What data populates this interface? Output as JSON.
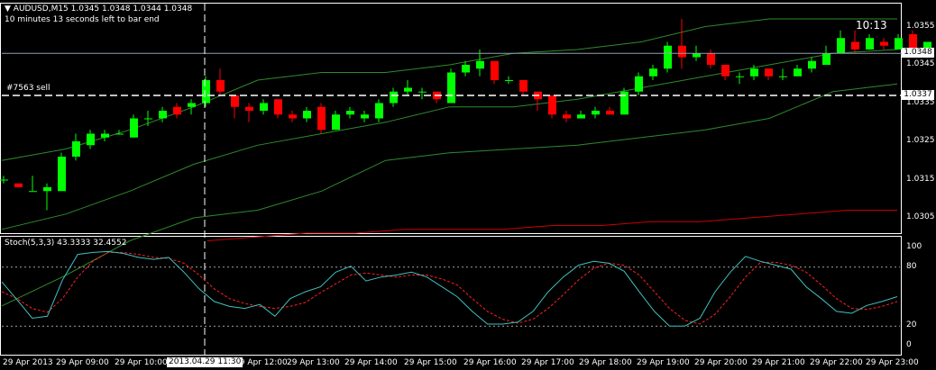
{
  "header": {
    "symbol_line": "AUDUSD,M15  1.0345 1.0348 1.0344 1.0348",
    "countdown_line": "10 minutes 13 seconds left to bar end",
    "timer": "10:13"
  },
  "order": {
    "label": "#7563 sell",
    "price": 1.0337,
    "price_label": "1.0337"
  },
  "current_price": {
    "value": 1.0348,
    "label": "1.0348"
  },
  "price_axis": {
    "ticks": [
      {
        "value": 1.0355,
        "label": "1.0355"
      },
      {
        "value": 1.0345,
        "label": "1.0345"
      },
      {
        "value": 1.0335,
        "label": "1.0335"
      },
      {
        "value": 1.0325,
        "label": "1.0325"
      },
      {
        "value": 1.0315,
        "label": "1.0315"
      },
      {
        "value": 1.0305,
        "label": "1.0305"
      }
    ],
    "min": 1.0301,
    "max": 1.0361
  },
  "stoch": {
    "title": "Stoch(5,3,3) 43.3333 32.4552",
    "levels": [
      80,
      20
    ],
    "ticks": [
      {
        "value": 100,
        "label": "100"
      },
      {
        "value": 80,
        "label": "80"
      },
      {
        "value": 20,
        "label": "20"
      },
      {
        "value": 0,
        "label": "0"
      }
    ]
  },
  "time_axis": {
    "labels": [
      "29 Apr 2013",
      "29 Apr 09:00",
      "29 Apr 10:00",
      "29 Apr 12:00",
      "29 Apr 13:00",
      "29 Apr 14:00",
      "29 Apr 15:00",
      "29 Apr 16:00",
      "29 Apr 17:00",
      "29 Apr 18:00",
      "29 Apr 19:00",
      "29 Apr 20:00",
      "29 Apr 21:00",
      "29 Apr 22:00",
      "29 Apr 23:00"
    ],
    "cursor_label": "2013.04.29 11:30"
  },
  "colors": {
    "bull": "#00ff00",
    "bear": "#ff0000",
    "band": "#2e8b2e",
    "ma": "#cc0000",
    "stoch_main": "#40c0c0",
    "stoch_signal": "#ff2020"
  },
  "chart_data": {
    "type": "candlestick",
    "candles": [
      {
        "o": 1.0315,
        "h": 1.0316,
        "l": 1.0314,
        "c": 1.0315
      },
      {
        "o": 1.0314,
        "h": 1.0314,
        "l": 1.0313,
        "c": 1.0313
      },
      {
        "o": 1.0312,
        "h": 1.0316,
        "l": 1.0312,
        "c": 1.0312
      },
      {
        "o": 1.0312,
        "h": 1.0314,
        "l": 1.0307,
        "c": 1.0313
      },
      {
        "o": 1.0312,
        "h": 1.0322,
        "l": 1.0312,
        "c": 1.0321
      },
      {
        "o": 1.0321,
        "h": 1.0327,
        "l": 1.032,
        "c": 1.0325
      },
      {
        "o": 1.0324,
        "h": 1.0328,
        "l": 1.0323,
        "c": 1.0327
      },
      {
        "o": 1.0326,
        "h": 1.0328,
        "l": 1.0325,
        "c": 1.0327
      },
      {
        "o": 1.0327,
        "h": 1.0328,
        "l": 1.0327,
        "c": 1.0327
      },
      {
        "o": 1.0326,
        "h": 1.0332,
        "l": 1.0326,
        "c": 1.0331
      },
      {
        "o": 1.0331,
        "h": 1.0333,
        "l": 1.0329,
        "c": 1.0331
      },
      {
        "o": 1.0331,
        "h": 1.0334,
        "l": 1.033,
        "c": 1.0333
      },
      {
        "o": 1.0334,
        "h": 1.0335,
        "l": 1.0331,
        "c": 1.0332
      },
      {
        "o": 1.0334,
        "h": 1.0336,
        "l": 1.0332,
        "c": 1.0335
      },
      {
        "o": 1.0335,
        "h": 1.0342,
        "l": 1.0334,
        "c": 1.0341
      },
      {
        "o": 1.0341,
        "h": 1.0344,
        "l": 1.0337,
        "c": 1.0338
      },
      {
        "o": 1.0337,
        "h": 1.0337,
        "l": 1.0331,
        "c": 1.0334
      },
      {
        "o": 1.0334,
        "h": 1.0335,
        "l": 1.033,
        "c": 1.0333
      },
      {
        "o": 1.0333,
        "h": 1.0336,
        "l": 1.0332,
        "c": 1.0335
      },
      {
        "o": 1.0336,
        "h": 1.0336,
        "l": 1.0331,
        "c": 1.0332
      },
      {
        "o": 1.0332,
        "h": 1.0333,
        "l": 1.033,
        "c": 1.0331
      },
      {
        "o": 1.0331,
        "h": 1.0334,
        "l": 1.033,
        "c": 1.0333
      },
      {
        "o": 1.0334,
        "h": 1.0335,
        "l": 1.0327,
        "c": 1.0328
      },
      {
        "o": 1.0328,
        "h": 1.0333,
        "l": 1.0328,
        "c": 1.0332
      },
      {
        "o": 1.0332,
        "h": 1.0334,
        "l": 1.0331,
        "c": 1.0333
      },
      {
        "o": 1.0331,
        "h": 1.0333,
        "l": 1.033,
        "c": 1.0332
      },
      {
        "o": 1.0331,
        "h": 1.0336,
        "l": 1.033,
        "c": 1.0335
      },
      {
        "o": 1.0335,
        "h": 1.0339,
        "l": 1.0334,
        "c": 1.0338
      },
      {
        "o": 1.0338,
        "h": 1.0341,
        "l": 1.0337,
        "c": 1.0339
      },
      {
        "o": 1.0338,
        "h": 1.0339,
        "l": 1.0336,
        "c": 1.0338
      },
      {
        "o": 1.0338,
        "h": 1.0338,
        "l": 1.0335,
        "c": 1.0336
      },
      {
        "o": 1.0335,
        "h": 1.0344,
        "l": 1.0335,
        "c": 1.0343
      },
      {
        "o": 1.0343,
        "h": 1.0346,
        "l": 1.0342,
        "c": 1.0345
      },
      {
        "o": 1.0344,
        "h": 1.0349,
        "l": 1.0342,
        "c": 1.0346
      },
      {
        "o": 1.0346,
        "h": 1.0346,
        "l": 1.034,
        "c": 1.0341
      },
      {
        "o": 1.0341,
        "h": 1.0342,
        "l": 1.034,
        "c": 1.0341
      },
      {
        "o": 1.0341,
        "h": 1.0341,
        "l": 1.0337,
        "c": 1.0338
      },
      {
        "o": 1.0338,
        "h": 1.0338,
        "l": 1.0333,
        "c": 1.0336
      },
      {
        "o": 1.0337,
        "h": 1.0337,
        "l": 1.0331,
        "c": 1.0332
      },
      {
        "o": 1.0332,
        "h": 1.0333,
        "l": 1.033,
        "c": 1.0331
      },
      {
        "o": 1.0331,
        "h": 1.0333,
        "l": 1.0331,
        "c": 1.0332
      },
      {
        "o": 1.0332,
        "h": 1.0334,
        "l": 1.0331,
        "c": 1.0333
      },
      {
        "o": 1.0333,
        "h": 1.0334,
        "l": 1.0332,
        "c": 1.0332
      },
      {
        "o": 1.0332,
        "h": 1.0339,
        "l": 1.0332,
        "c": 1.0338
      },
      {
        "o": 1.0338,
        "h": 1.0343,
        "l": 1.0337,
        "c": 1.0342
      },
      {
        "o": 1.0342,
        "h": 1.0345,
        "l": 1.0341,
        "c": 1.0344
      },
      {
        "o": 1.0344,
        "h": 1.0351,
        "l": 1.0343,
        "c": 1.035
      },
      {
        "o": 1.035,
        "h": 1.0357,
        "l": 1.0344,
        "c": 1.0347
      },
      {
        "o": 1.0347,
        "h": 1.035,
        "l": 1.0346,
        "c": 1.0348
      },
      {
        "o": 1.0348,
        "h": 1.0349,
        "l": 1.0344,
        "c": 1.0345
      },
      {
        "o": 1.0345,
        "h": 1.0345,
        "l": 1.0341,
        "c": 1.0342
      },
      {
        "o": 1.0342,
        "h": 1.0343,
        "l": 1.034,
        "c": 1.0342
      },
      {
        "o": 1.0342,
        "h": 1.0345,
        "l": 1.0341,
        "c": 1.0344
      },
      {
        "o": 1.0344,
        "h": 1.0344,
        "l": 1.0341,
        "c": 1.0342
      },
      {
        "o": 1.0342,
        "h": 1.0344,
        "l": 1.0341,
        "c": 1.0342
      },
      {
        "o": 1.0342,
        "h": 1.0345,
        "l": 1.0342,
        "c": 1.0344
      },
      {
        "o": 1.0344,
        "h": 1.0347,
        "l": 1.0343,
        "c": 1.0346
      },
      {
        "o": 1.0345,
        "h": 1.035,
        "l": 1.0345,
        "c": 1.0348
      },
      {
        "o": 1.0348,
        "h": 1.0354,
        "l": 1.0348,
        "c": 1.0352
      },
      {
        "o": 1.0351,
        "h": 1.0354,
        "l": 1.0348,
        "c": 1.0349
      },
      {
        "o": 1.0349,
        "h": 1.0353,
        "l": 1.0349,
        "c": 1.0352
      },
      {
        "o": 1.0351,
        "h": 1.0352,
        "l": 1.0349,
        "c": 1.035
      },
      {
        "o": 1.0349,
        "h": 1.0353,
        "l": 1.0349,
        "c": 1.0352
      },
      {
        "o": 1.0353,
        "h": 1.0354,
        "l": 1.0348,
        "c": 1.0349
      },
      {
        "o": 1.0349,
        "h": 1.0351,
        "l": 1.0348,
        "c": 1.0351
      },
      {
        "o": 1.035,
        "h": 1.0353,
        "l": 1.0348,
        "c": 1.0352
      },
      {
        "o": 1.0351,
        "h": 1.0352,
        "l": 1.0349,
        "c": 1.0351
      },
      {
        "o": 1.0348,
        "h": 1.0353,
        "l": 1.0347,
        "c": 1.0351
      },
      {
        "o": 1.0351,
        "h": 1.0353,
        "l": 1.0349,
        "c": 1.0352
      },
      {
        "o": 1.0351,
        "h": 1.0352,
        "l": 1.0347,
        "c": 1.0348
      }
    ],
    "bands": {
      "upper": [
        1.032,
        1.0323,
        1.0328,
        1.0334,
        1.0341,
        1.0343,
        1.0343,
        1.0345,
        1.0348,
        1.0349,
        1.0351,
        1.0355,
        1.0357,
        1.0357,
        1.0357
      ],
      "middle": [
        1.0302,
        1.0306,
        1.0312,
        1.0319,
        1.0324,
        1.0327,
        1.033,
        1.0334,
        1.0334,
        1.0336,
        1.0339,
        1.0342,
        1.0345,
        1.0348,
        1.0349
      ],
      "lower": [
        1.0282,
        1.029,
        1.0299,
        1.0305,
        1.0307,
        1.0312,
        1.032,
        1.0322,
        1.0323,
        1.0324,
        1.0326,
        1.0328,
        1.0331,
        1.0338,
        1.034
      ]
    },
    "ma": [
      1.0299,
      1.03,
      1.0301,
      1.0301,
      1.0302,
      1.0302,
      1.0302,
      1.0303,
      1.0303,
      1.0304,
      1.0304,
      1.0305,
      1.0306,
      1.0307,
      1.0307
    ],
    "stoch_main": [
      65,
      47,
      28,
      30,
      67,
      93,
      95,
      96,
      94,
      90,
      88,
      90,
      75,
      58,
      45,
      40,
      38,
      42,
      30,
      48,
      55,
      60,
      75,
      81,
      66,
      70,
      72,
      75,
      70,
      60,
      50,
      35,
      22,
      22,
      24,
      35,
      55,
      70,
      82,
      86,
      84,
      76,
      55,
      35,
      20,
      20,
      28,
      55,
      75,
      91,
      86,
      82,
      78,
      60,
      48,
      35,
      33,
      41,
      45,
      50
    ],
    "stoch_signal": [
      55,
      48,
      38,
      34,
      48,
      70,
      86,
      95,
      95,
      93,
      90,
      89,
      84,
      72,
      58,
      48,
      43,
      40,
      38,
      40,
      44,
      54,
      63,
      72,
      74,
      72,
      70,
      72,
      72,
      68,
      62,
      48,
      35,
      27,
      23,
      27,
      38,
      52,
      67,
      79,
      84,
      82,
      72,
      55,
      38,
      26,
      22,
      32,
      50,
      70,
      85,
      85,
      82,
      75,
      62,
      48,
      38,
      37,
      40,
      45
    ],
    "ylim": [
      1.0301,
      1.0361
    ],
    "stoch_ylim": [
      0,
      100
    ]
  }
}
